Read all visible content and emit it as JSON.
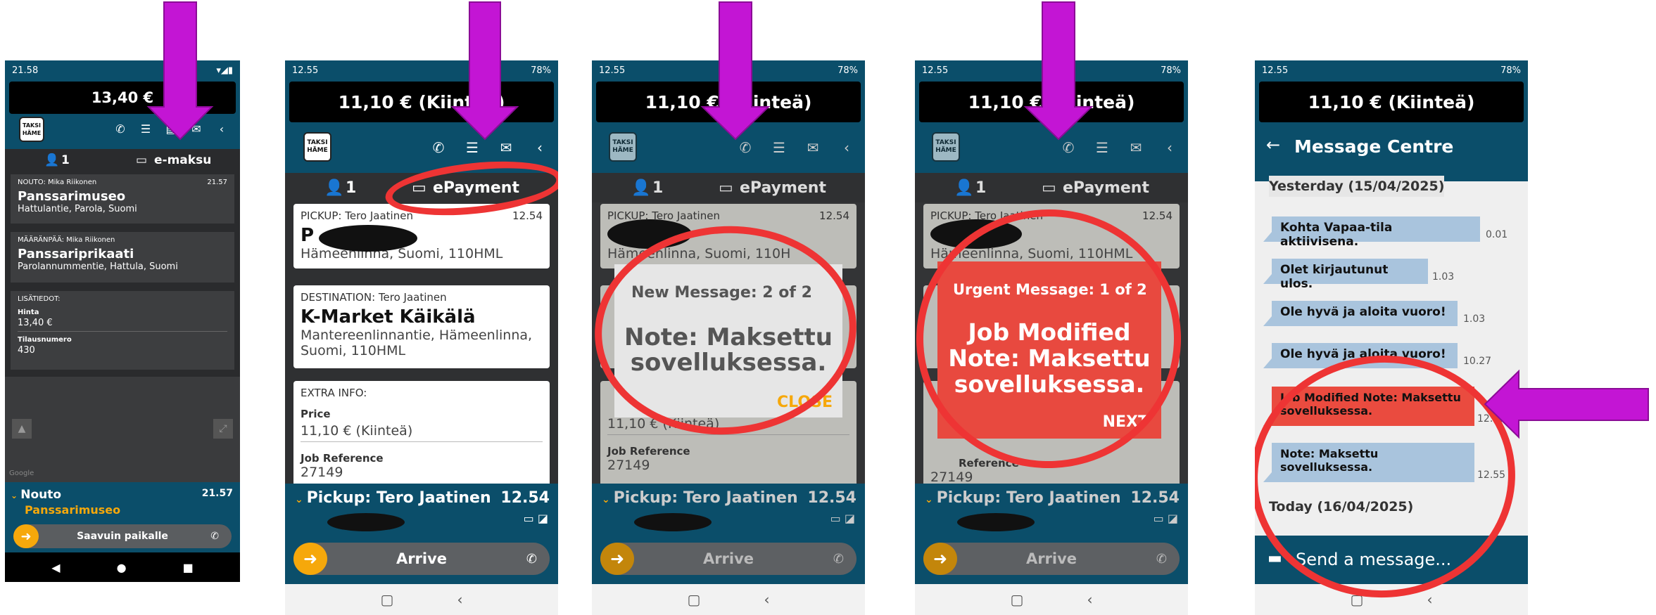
{
  "screens": [
    {
      "status": {
        "time": "21.58",
        "icons": "G G",
        "right": "▾◢▮"
      },
      "price": "13,40 €",
      "logo": "TAKSI\nHÄME",
      "passengers": "1",
      "payment": "e-maksu",
      "pickup": {
        "label": "NOUTO: Mika Riikonen",
        "time": "21.57",
        "name": "Panssarimuseo",
        "address": "Hattulantie, Parola, Suomi"
      },
      "destination": {
        "label": "MÄÄRÄNPÄÄ: Mika Riikonen",
        "name": "Panssariprikaati",
        "address": "Parolannummentie, Hattula, Suomi"
      },
      "extra": {
        "label": "LISÄTIEDOT:",
        "price_label": "Hinta",
        "price": "13,40 €",
        "ref_label": "Tilausnumero",
        "ref": "430"
      },
      "map_label": "Google",
      "bottom": {
        "title": "Nouto",
        "time": "21.57",
        "place": "Panssarimuseo"
      },
      "action": "Saavuin paikalle"
    },
    {
      "status": {
        "time": "12.55",
        "right": "78%"
      },
      "price": "11,10 € (Kiinteä)",
      "logo": "TAKSI\nHÄME",
      "passengers": "1",
      "payment": "ePayment",
      "pickup": {
        "label": "PICKUP: Tero Jaatinen",
        "time": "12.54",
        "name": "P",
        "address": "Hämeenlinna, Suomi, 110HML"
      },
      "destination": {
        "label": "DESTINATION: Tero Jaatinen",
        "name": "K-Market Käikälä",
        "address": "Mantereenlinnantie, Hämeenlinna, Suomi, 110HML"
      },
      "extra": {
        "label": "EXTRA INFO:",
        "price_label": "Price",
        "price": "11,10 € (Kiinteä)",
        "ref_label": "Job Reference",
        "ref": "27149"
      },
      "bottom": {
        "title": "Pickup: Tero Jaatinen",
        "time": "12.54"
      },
      "action": "Arrive"
    },
    {
      "status": {
        "time": "12.55",
        "right": "78%"
      },
      "price": "11,10 € (Kiinteä)",
      "popup": {
        "header": "New Message: 2 of 2",
        "body": "Note: Maksettu sovelluksessa.",
        "button": "CLOSE"
      },
      "pickup": {
        "label": "PICKUP: Tero Jaatinen",
        "time": "12.54",
        "address": "Hämeenlinna, Suomi, 110H"
      },
      "extra": {
        "price": "11,10 € (Kiinteä)",
        "ref_label": "Job Reference",
        "ref": "27149"
      },
      "bottom": {
        "title": "Pickup: Tero Jaatinen",
        "time": "12.54"
      },
      "action": "Arrive"
    },
    {
      "status": {
        "time": "12.55",
        "right": "78%"
      },
      "price": "11,10 € (Kiinteä)",
      "popup": {
        "header": "Urgent Message: 1 of 2",
        "body": "Job Modified Note: Maksettu sovelluksessa.",
        "button": "NEXT"
      },
      "pickup": {
        "label": "PICKUP: Tero Jaatinen",
        "time": "12.54",
        "address": "Hämeenlinna, Suomi, 110HML"
      },
      "extra": {
        "ref_label": "Reference",
        "ref": "27149"
      },
      "bottom": {
        "title": "Pickup: Tero Jaatinen",
        "time": "12.54"
      },
      "action": "Arrive"
    },
    {
      "status": {
        "time": "12.55",
        "right": "78%"
      },
      "price": "11,10 € (Kiinteä)",
      "title": "Message Centre",
      "yesterday": "Yesterday (15/04/2025)",
      "messages": [
        {
          "text": "Kohta Vapaa-tila aktiivisena.",
          "time": "0.01"
        },
        {
          "text": "Olet kirjautunut ulos.",
          "time": "1.03"
        },
        {
          "text": "Ole hyvä ja aloita vuoro!",
          "time": "1.03"
        },
        {
          "text": "Ole hyvä ja aloita vuoro!",
          "time": "10.27"
        },
        {
          "text": "Job Modified Note: Maksettu sovelluksessa.",
          "time": "12.55"
        },
        {
          "text": "Note: Maksettu sovelluksessa.",
          "time": "12.55"
        }
      ],
      "today": "Today (16/04/2025)",
      "send_placeholder": "Send a message..."
    }
  ],
  "colors": {
    "dark_blue": "#0b4e6a",
    "accent_yellow": "#f6a80b",
    "urgent_red": "#e8493f",
    "annotation_magenta": "#c315d4",
    "annotation_red": "#ee3434"
  }
}
